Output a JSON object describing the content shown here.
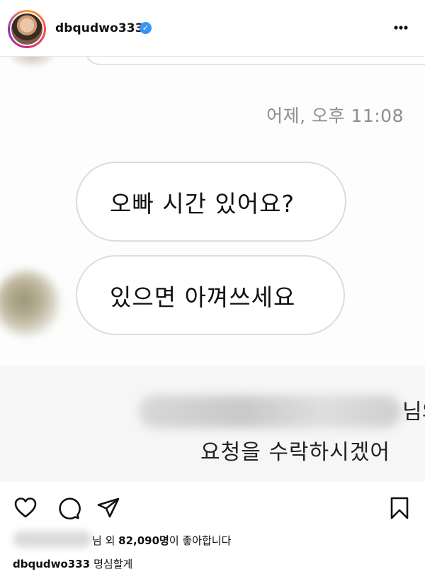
{
  "header": {
    "username": "dbqudwo333",
    "verified_icon": "✓",
    "more_label": "⋮"
  },
  "post": {
    "timestamp": "어제, 오후 11:08",
    "messages": [
      "오빠 시간 있어요?",
      "있으면 아껴쓰세요"
    ],
    "request_suffix": "님의",
    "request_line2": "요청을 수락하시겠어"
  },
  "likes": {
    "prefix": "님 외 ",
    "count": "82,090명",
    "suffix": "이 좋아합니다"
  },
  "caption": {
    "username": "dbqudwo333",
    "text": "명심할게"
  },
  "icons": {
    "like": "heart-icon",
    "comment": "comment-icon",
    "share": "share-icon",
    "save": "bookmark-icon"
  },
  "colors": {
    "verified": "#3797f0",
    "timestamp": "#8e8e8e",
    "bubble_border": "#dcdcdc"
  }
}
